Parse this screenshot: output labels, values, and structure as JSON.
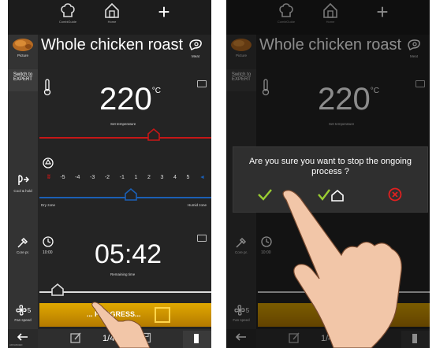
{
  "top_nav": {
    "combi_guide_label": "CombiGuide",
    "home_label": "Home",
    "add_symbol": "+"
  },
  "recipe": {
    "title": "Whole chicken roast",
    "picture_label": "Picture",
    "meat_label": "Meat"
  },
  "side": {
    "switch_expert_label": "Switch to\nEXPERT",
    "cool_hold_label": "Cool & hold",
    "core_probe_label": "Core pr.",
    "fan_speed_label": "Fan speed",
    "fan_speed_value": "5"
  },
  "temperature": {
    "value": "220",
    "unit": "°C",
    "label": "Set temperature",
    "slider_fraction": 0.7
  },
  "humidity": {
    "scale": [
      "-5",
      "-4",
      "-3",
      "-2",
      "-1",
      "1",
      "2",
      "3",
      "4",
      "5"
    ],
    "dry_label": "Dry zone",
    "humid_label": "Humid zone",
    "slider_fraction": 0.55
  },
  "timer": {
    "start_time": "10:00",
    "value": "05:42",
    "label": "Remaining time",
    "slider_fraction": 0.08
  },
  "progress": {
    "text": "... PROGRESS..."
  },
  "bottom_nav": {
    "page_indicator": "1/4",
    "left_corner_label": "ADVANCED"
  },
  "dialog": {
    "message": "Are you sure you want to stop the ongoing process ?"
  },
  "colors": {
    "red": "#c61717",
    "blue": "#1b5fb5",
    "amber": "#e0a800",
    "confirm_green": "#9acd32"
  },
  "icons": [
    "chef-hat-icon",
    "home-icon",
    "plus-icon",
    "meat-icon",
    "thermometer-icon",
    "drop-icon",
    "cool-hold-icon",
    "core-probe-icon",
    "clock-icon",
    "fan-icon",
    "back-arrow-icon",
    "edit-icon",
    "save-icon",
    "keyboard-icon",
    "checkmark-icon",
    "check-home-icon",
    "cancel-icon",
    "hand-pointer-icon"
  ]
}
